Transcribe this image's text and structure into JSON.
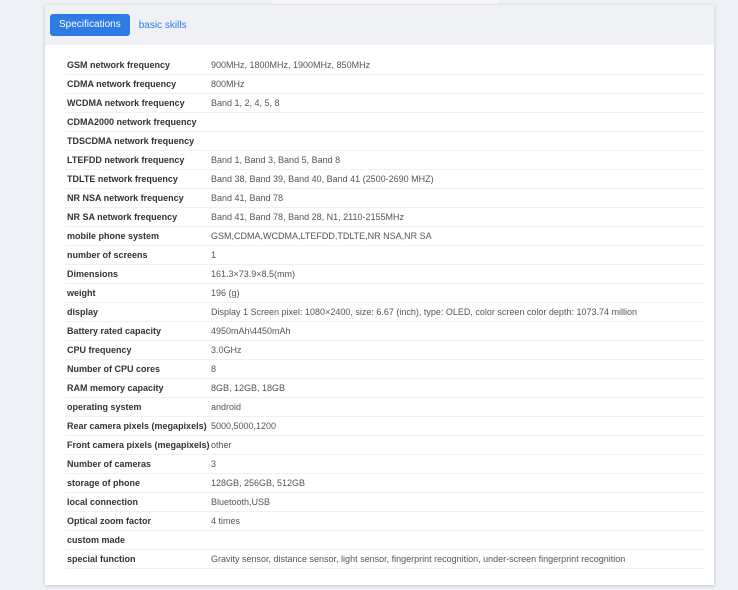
{
  "tabs": [
    {
      "label": "Specifications",
      "active": true
    },
    {
      "label": "basic skills",
      "active": false
    }
  ],
  "specs": [
    {
      "label": "GSM network frequency",
      "value": "900MHz, 1800MHz, 1900MHz, 850MHz"
    },
    {
      "label": "CDMA network frequency",
      "value": "800MHz"
    },
    {
      "label": "WCDMA network frequency",
      "value": "Band 1, 2, 4, 5, 8"
    },
    {
      "label": "CDMA2000 network frequency",
      "value": ""
    },
    {
      "label": "TDSCDMA network frequency",
      "value": ""
    },
    {
      "label": "LTEFDD network frequency",
      "value": "Band 1, Band 3, Band 5, Band 8"
    },
    {
      "label": "TDLTE network frequency",
      "value": "Band 38, Band 39, Band 40, Band 41 (2500-2690 MHZ)"
    },
    {
      "label": "NR NSA network frequency",
      "value": "Band 41, Band 78"
    },
    {
      "label": "NR SA network frequency",
      "value": "Band 41, Band 78, Band 28, N1, 2110-2155MHz"
    },
    {
      "label": "mobile phone system",
      "value": "GSM,CDMA,WCDMA,LTEFDD,TDLTE,NR NSA,NR SA"
    },
    {
      "label": "number of screens",
      "value": "1"
    },
    {
      "label": "Dimensions",
      "value": "161.3×73.9×8.5(mm)"
    },
    {
      "label": "weight",
      "value": "196 (g)"
    },
    {
      "label": "display",
      "value": "Display 1 Screen pixel: 1080×2400, size: 6.67 (inch), type: OLED, color screen color depth: 1073.74 million"
    },
    {
      "label": "Battery rated capacity",
      "value": "4950mAh\\4450mAh"
    },
    {
      "label": "CPU frequency",
      "value": "3.0GHz"
    },
    {
      "label": "Number of CPU cores",
      "value": "8"
    },
    {
      "label": "RAM memory capacity",
      "value": "8GB, 12GB, 18GB"
    },
    {
      "label": "operating system",
      "value": "android"
    },
    {
      "label": "Rear camera pixels (megapixels)",
      "value": "5000,5000,1200"
    },
    {
      "label": "Front camera pixels (megapixels)",
      "value": "other"
    },
    {
      "label": "Number of cameras",
      "value": "3"
    },
    {
      "label": "storage of phone",
      "value": "128GB, 256GB, 512GB"
    },
    {
      "label": "local connection",
      "value": "Bluetooth,USB"
    },
    {
      "label": "Optical zoom factor",
      "value": "4 times"
    },
    {
      "label": "custom made",
      "value": ""
    },
    {
      "label": "special function",
      "value": "Gravity sensor, distance sensor, light sensor, fingerprint recognition, under-screen fingerprint recognition"
    }
  ]
}
